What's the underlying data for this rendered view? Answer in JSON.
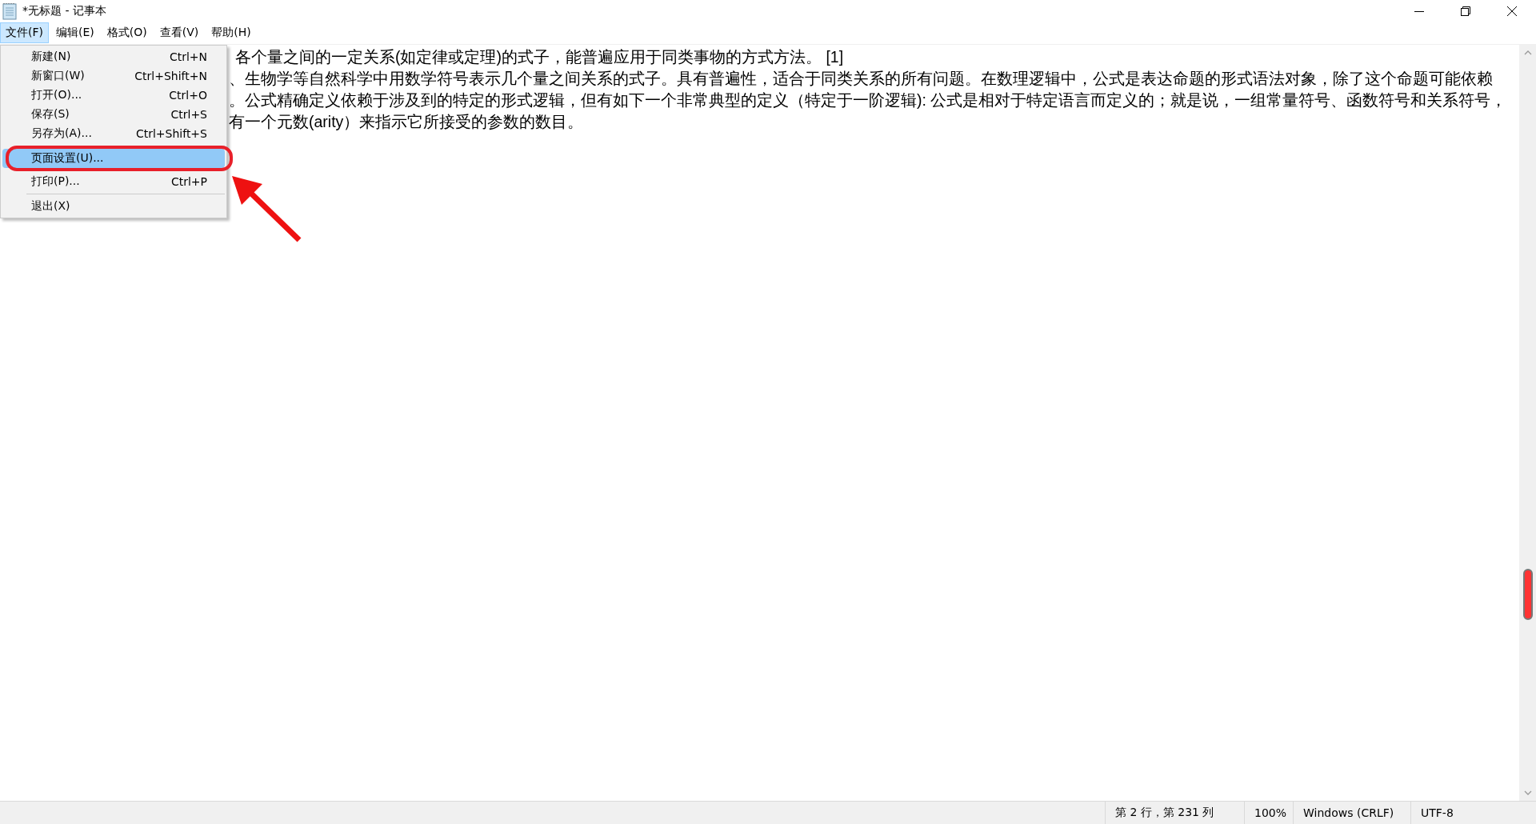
{
  "window": {
    "title": "*无标题 - 记事本"
  },
  "menu_bar": [
    {
      "label": "文件(F)",
      "selected": true
    },
    {
      "label": "编辑(E)",
      "selected": false
    },
    {
      "label": "格式(O)",
      "selected": false
    },
    {
      "label": "查看(V)",
      "selected": false
    },
    {
      "label": "帮助(H)",
      "selected": false
    }
  ],
  "file_menu": {
    "items": [
      {
        "kind": "item",
        "label": "新建(N)",
        "shortcut": "Ctrl+N",
        "selected": false
      },
      {
        "kind": "item",
        "label": "新窗口(W)",
        "shortcut": "Ctrl+Shift+N",
        "selected": false
      },
      {
        "kind": "item",
        "label": "打开(O)...",
        "shortcut": "Ctrl+O",
        "selected": false
      },
      {
        "kind": "item",
        "label": "保存(S)",
        "shortcut": "Ctrl+S",
        "selected": false
      },
      {
        "kind": "item",
        "label": "另存为(A)...",
        "shortcut": "Ctrl+Shift+S",
        "selected": false
      },
      {
        "kind": "separator"
      },
      {
        "kind": "item",
        "label": "页面设置(U)...",
        "selected": true
      },
      {
        "kind": "item",
        "label": "打印(P)...",
        "shortcut": "Ctrl+P",
        "selected": false
      },
      {
        "kind": "separator"
      },
      {
        "kind": "item",
        "label": "退出(X)",
        "selected": false
      }
    ]
  },
  "document": {
    "lines": [
      "各个量之间的一定关系(如定律或定理)的式子，能普遍应用于同类事物的方式方法。 [1]",
      "、生物学等自然科学中用数学符号表示几个量之间关系的式子。具有普遍性，适合于同类关系的所有问题。在数理逻辑中，公式是表达命题的形式语法对象，除了这个命题可能依赖",
      "。公式精确定义依赖于涉及到的特定的形式逻辑，但有如下一个非常典型的定义（特定于一阶逻辑): 公式是相对于特定语言而定义的；就是说，一组常量符号、函数符号和关系符号，",
      "有一个元数(arity）来指示它所接受的参数的数目。"
    ]
  },
  "status_bar": [
    "第 2 行，第 231 列",
    "100%",
    "Windows (CRLF)",
    "UTF-8"
  ]
}
